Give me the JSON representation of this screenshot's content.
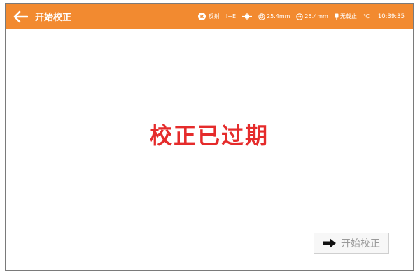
{
  "header": {
    "title": "开始校正",
    "back_icon": "back-arrow-icon",
    "bg_color": "#f28a30"
  },
  "status": {
    "mode_badge": "R",
    "mode_label": "反射",
    "ie_label": "I+E",
    "connector_icon": "connector-icon",
    "ring1_value": "25.4mm",
    "ring2_value": "25.4mm",
    "carrier_label": "无载止",
    "temp_unit": "℃",
    "time": "10:39:35"
  },
  "main": {
    "message": "校正已过期",
    "message_color": "#e52b2b",
    "start_button_label": "开始校正",
    "start_button_icon": "right-arrow-icon"
  }
}
